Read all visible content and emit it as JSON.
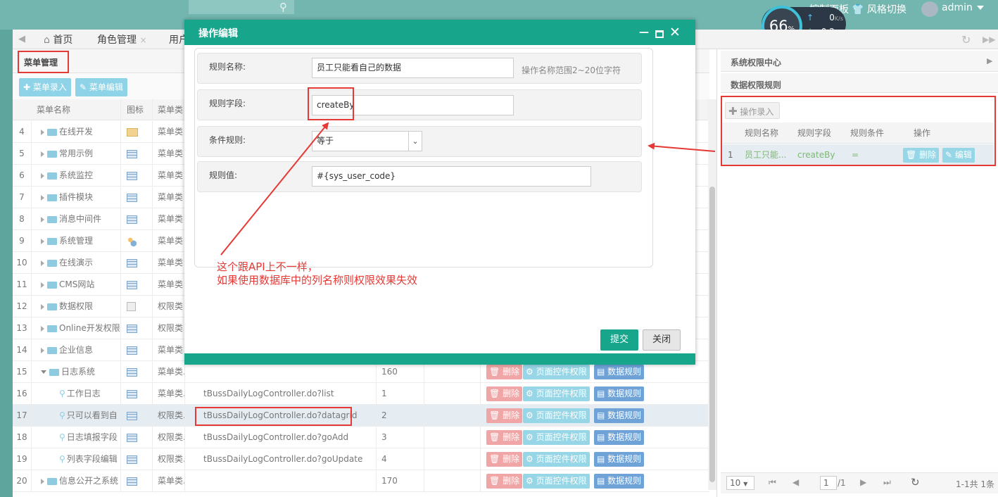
{
  "topbar": {
    "control_panel": "控制面板",
    "theme_switch": "风格切换",
    "user": "admin"
  },
  "speed": {
    "percent": "66",
    "percent_unit": "%",
    "up": "0",
    "down": "0.2",
    "unit": "K/s"
  },
  "tabs": {
    "home": "首页",
    "role": "角色管理",
    "user": "用户"
  },
  "left": {
    "title": "菜单管理",
    "add_btn": "菜单录入",
    "edit_btn": "菜单编辑",
    "col_name": "菜单名称",
    "col_icon": "图标",
    "col_type": "菜单类"
  },
  "rows": [
    {
      "no": "4",
      "name": "在线开发",
      "icon": "folder",
      "type": "菜单类",
      "url": "",
      "order": "",
      "level": 1
    },
    {
      "no": "5",
      "name": "常用示例",
      "icon": "grid",
      "type": "菜单类",
      "url": "",
      "order": "",
      "level": 1
    },
    {
      "no": "6",
      "name": "系统监控",
      "icon": "grid",
      "type": "菜单类",
      "url": "",
      "order": "",
      "level": 1
    },
    {
      "no": "7",
      "name": "插件模块",
      "icon": "grid",
      "type": "菜单类",
      "url": "",
      "order": "",
      "level": 1
    },
    {
      "no": "8",
      "name": "消息中间件",
      "icon": "grid",
      "type": "菜单类",
      "url": "",
      "order": "",
      "level": 1
    },
    {
      "no": "9",
      "name": "系统管理",
      "icon": "users",
      "type": "菜单类",
      "url": "",
      "order": "",
      "level": 1
    },
    {
      "no": "10",
      "name": "在线演示",
      "icon": "grid",
      "type": "菜单类",
      "url": "",
      "order": "",
      "level": 1
    },
    {
      "no": "11",
      "name": "CMS网站",
      "icon": "grid",
      "type": "菜单类",
      "url": "",
      "order": "",
      "level": 1
    },
    {
      "no": "12",
      "name": "数据权限",
      "icon": "copy",
      "type": "权限类",
      "url": "",
      "order": "",
      "level": 1
    },
    {
      "no": "13",
      "name": "Online开发权限",
      "icon": "grid",
      "type": "权限类",
      "url": "",
      "order": "",
      "level": 1
    },
    {
      "no": "14",
      "name": "企业信息",
      "icon": "grid",
      "type": "菜单类",
      "url": "",
      "order": "",
      "level": 1
    },
    {
      "no": "15",
      "name": "日志系统",
      "icon": "grid",
      "type": "菜单类...",
      "url": "",
      "order": "160",
      "level": 1,
      "open": true
    },
    {
      "no": "16",
      "name": "工作日志",
      "icon": "grid",
      "type": "菜单类...",
      "url": "tBussDailyLogController.do?list",
      "order": "1",
      "level": 2
    },
    {
      "no": "17",
      "name": "只可以看到自",
      "icon": "grid",
      "type": "权限类...",
      "url": "tBussDailyLogController.do?datagrid",
      "order": "2",
      "level": 2,
      "selected": true
    },
    {
      "no": "18",
      "name": "日志填报字段",
      "icon": "grid",
      "type": "权限类...",
      "url": "tBussDailyLogController.do?goAdd",
      "order": "3",
      "level": 2
    },
    {
      "no": "19",
      "name": "列表字段编辑",
      "icon": "grid",
      "type": "权限类...",
      "url": "tBussDailyLogController.do?goUpdate",
      "order": "4",
      "level": 2
    },
    {
      "no": "20",
      "name": "信息公开之系统",
      "icon": "grid",
      "type": "菜单类...",
      "url": "",
      "order": "170",
      "level": 1
    }
  ],
  "row_ops": {
    "delete": "删除",
    "page_perm": "页面控件权限",
    "data_rule": "数据规则"
  },
  "right": {
    "center_title": "系统权限中心",
    "rule_title": "数据权限规则",
    "add_btn": "操作录入",
    "cols": [
      "规则名称",
      "规则字段",
      "规则条件",
      "操作"
    ],
    "row": {
      "no": "1",
      "name": "员工只能...",
      "field": "createBy",
      "cond": "=",
      "del": "删除",
      "edit": "编辑"
    },
    "pager": {
      "size": "10",
      "page": "1",
      "total_pages": "/1",
      "summary": "1-1共 1条"
    }
  },
  "modal": {
    "title": "操作编辑",
    "rule_name_label": "规则名称:",
    "rule_name_value": "员工只能看自己的数据",
    "rule_name_hint": "操作名称范围2~20位字符",
    "rule_field_label": "规则字段:",
    "rule_field_value": "createBy",
    "condition_label": "条件规则:",
    "condition_value": "等于",
    "rule_value_label": "规则值:",
    "rule_value_value": "#{sys_user_code}",
    "submit": "提交",
    "close": "关闭"
  },
  "annotation": {
    "line1": "这个跟API上不一样，",
    "line2": "如果使用数据库中的列名称则权限效果失效"
  },
  "colors": {
    "accent": "#17a58b",
    "highlight": "#e53935",
    "topbar": "#73b6b0"
  }
}
